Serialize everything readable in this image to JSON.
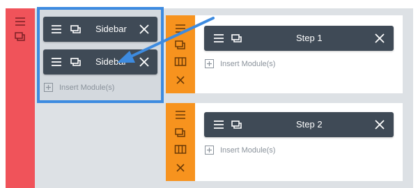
{
  "colors": {
    "section_strip": "#f0535a",
    "row_strip": "#f7931e",
    "module_bg": "#3f4a56",
    "highlight": "#3d8be0",
    "builder_bg": "#dde1e5"
  },
  "section": {
    "icons": [
      "hamburger-menu-icon",
      "duplicate-icon"
    ]
  },
  "sidebar_column": {
    "modules": [
      {
        "label": "Sidebar"
      },
      {
        "label": "Sidebar"
      }
    ],
    "insert_label": "Insert Module(s)"
  },
  "rows": [
    {
      "icons": [
        "hamburger-menu-icon",
        "duplicate-icon",
        "columns-icon",
        "close-icon"
      ],
      "module": {
        "label": "Step 1"
      },
      "insert_label": "Insert Module(s)"
    },
    {
      "icons": [
        "hamburger-menu-icon",
        "duplicate-icon",
        "columns-icon",
        "close-icon"
      ],
      "module": {
        "label": "Step 2"
      },
      "insert_label": "Insert Module(s)"
    }
  ],
  "annotation": {
    "type": "arrow",
    "from": "row-1-module",
    "to": "sidebar-module-2"
  }
}
